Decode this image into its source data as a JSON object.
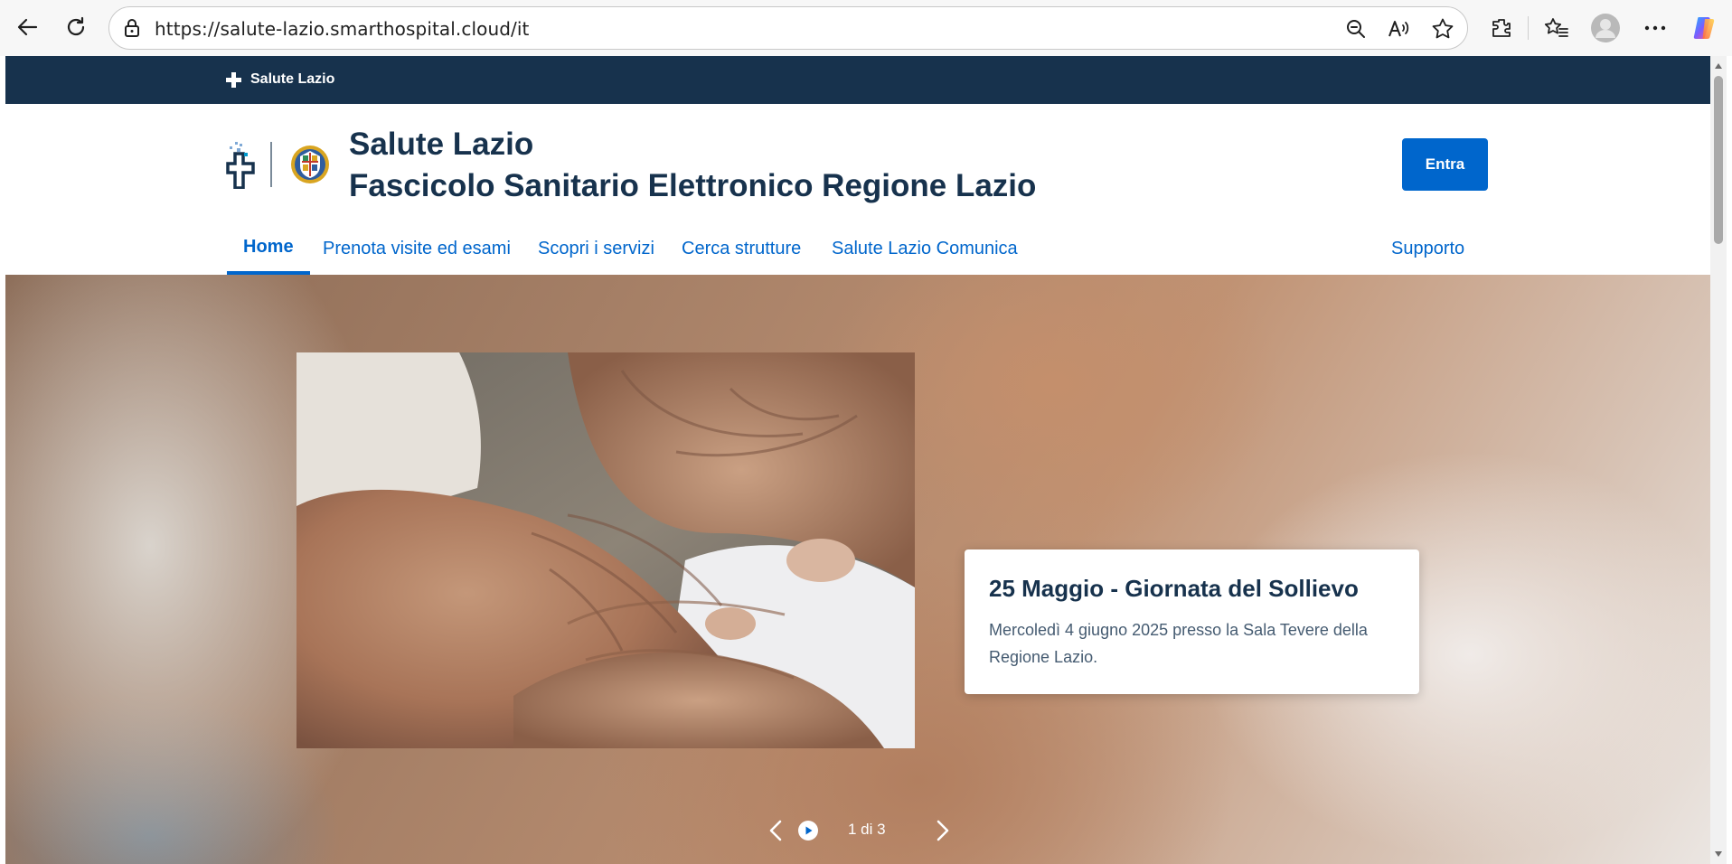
{
  "browser": {
    "url": "https://salute-lazio.smarthospital.cloud/it",
    "icons": [
      "back-icon",
      "refresh-icon",
      "lock-icon",
      "zoom-out-icon",
      "read-aloud-icon",
      "favorite-star-icon",
      "extensions-icon",
      "favorites-icon",
      "profile-icon",
      "more-icon",
      "copilot-icon"
    ]
  },
  "slim_header": {
    "brand": "Salute Lazio"
  },
  "header": {
    "title_line1": "Salute Lazio",
    "title_line2": "Fascicolo Sanitario Elettronico Regione Lazio",
    "login_label": "Entra"
  },
  "navbar": {
    "items": [
      {
        "label": "Home",
        "active": true
      },
      {
        "label": "Prenota visite ed esami"
      },
      {
        "label": "Scopri i servizi"
      },
      {
        "label": "Cerca strutture"
      },
      {
        "label": "Salute Lazio Comunica"
      }
    ],
    "support_label": "Supporto"
  },
  "hero": {
    "card_title": "25 Maggio - Giornata del Sollievo",
    "card_text": "Mercoledì 4 giugno 2025 presso la Sala Tevere della Regione Lazio.",
    "pager": "1 di 3"
  },
  "colors": {
    "primary": "#0066cc",
    "dark_blue": "#17324d"
  }
}
